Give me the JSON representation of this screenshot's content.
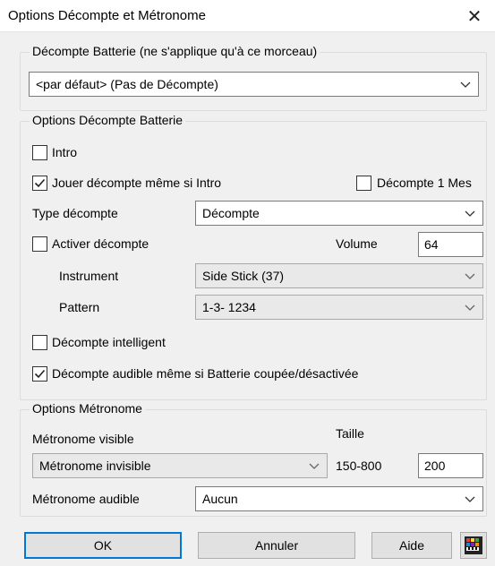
{
  "window": {
    "title": "Options Décompte et Métronome",
    "close_glyph": "✕"
  },
  "countin_group": {
    "title": "Décompte Batterie (ne s'applique qu'à ce morceau)",
    "selected": "<par défaut> (Pas de Décompte)"
  },
  "drum_options": {
    "title": "Options Décompte Batterie",
    "intro": {
      "label": "Intro",
      "checked": false
    },
    "play_countin_even_intro": {
      "label": "Jouer décompte même si Intro",
      "checked": true
    },
    "countin_one_bar": {
      "label": "Décompte 1 Mes",
      "checked": false
    },
    "countin_type": {
      "label": "Type décompte",
      "selected": "Décompte"
    },
    "enable_countin": {
      "label": "Activer décompte",
      "checked": false
    },
    "volume": {
      "label": "Volume",
      "value": "64"
    },
    "instrument": {
      "label": "Instrument",
      "selected": "Side Stick (37)"
    },
    "pattern": {
      "label": "Pattern",
      "selected": "1-3- 1234"
    },
    "smart_countin": {
      "label": "Décompte intelligent",
      "checked": false
    },
    "audible_countin": {
      "label": "Décompte audible même si Batterie coupée/désactivée",
      "checked": true
    }
  },
  "metronome": {
    "title": "Options Métronome",
    "visible_label": "Métronome visible",
    "visible_selected": "Métronome invisible",
    "size_label": "Taille",
    "size_range": "150-800",
    "size_value": "200",
    "audible_label": "Métronome audible",
    "audible_selected": "Aucun"
  },
  "buttons": {
    "ok": "OK",
    "cancel": "Annuler",
    "help": "Aide"
  },
  "icons": {
    "app": "app-color-icon",
    "chevron": "chevron-down-icon",
    "check": "check-icon"
  }
}
